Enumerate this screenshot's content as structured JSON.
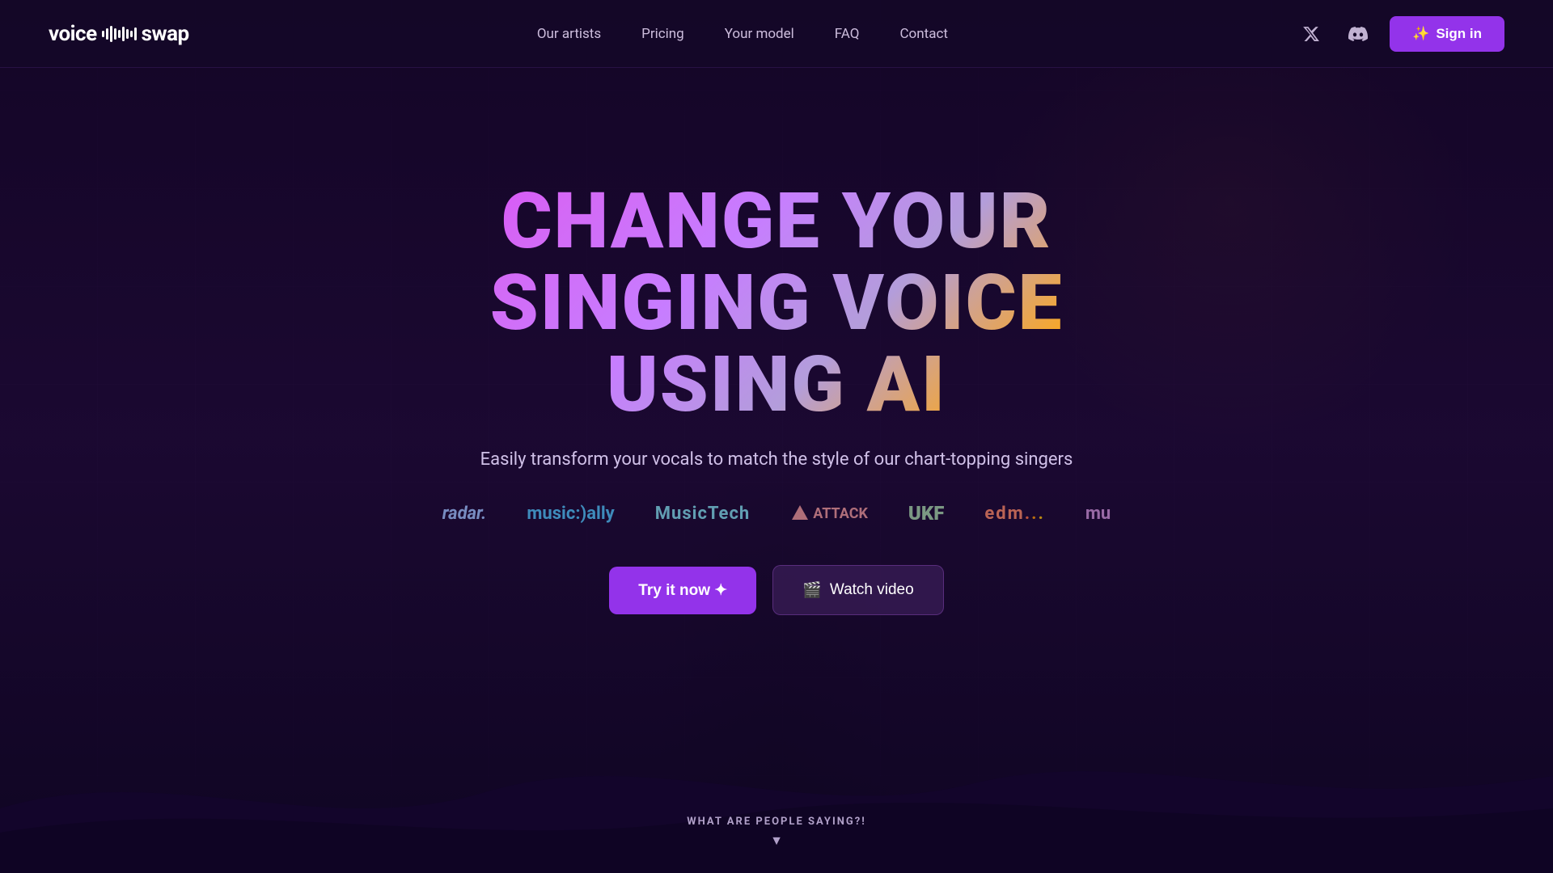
{
  "site": {
    "logo_voice": "voice",
    "logo_swap": "swap"
  },
  "nav": {
    "links": [
      {
        "id": "our-artists",
        "label": "Our artists"
      },
      {
        "id": "pricing",
        "label": "Pricing"
      },
      {
        "id": "your-model",
        "label": "Your model"
      },
      {
        "id": "faq",
        "label": "FAQ"
      },
      {
        "id": "contact",
        "label": "Contact"
      }
    ],
    "signin_label": "Sign in"
  },
  "hero": {
    "title_line1": "CHANGE YOUR SINGING VOICE",
    "title_line2": "USING AI",
    "subtitle": "Easily transform your vocals to match the style of our chart-topping singers",
    "cta_try": "Try it now ✦",
    "cta_watch": "Watch video"
  },
  "logos": [
    {
      "id": "radar",
      "label": "radar.",
      "class": "logo-radar"
    },
    {
      "id": "musicaly",
      "label": "music:)ally",
      "class": "logo-musicaly"
    },
    {
      "id": "musictech",
      "label": "MusicTech",
      "class": "logo-musictech"
    },
    {
      "id": "attack",
      "label": "⚡ ATTACK",
      "class": "logo-attack"
    },
    {
      "id": "ukf",
      "label": "UKF",
      "class": "logo-ukf"
    },
    {
      "id": "edm",
      "label": "edm...",
      "class": "logo-edm"
    },
    {
      "id": "mu",
      "label": "mu",
      "class": "logo-mu"
    }
  ],
  "scroll_hint": {
    "text": "WHAT ARE PEOPLE SAYING?!",
    "arrow": "▼"
  },
  "colors": {
    "brand_purple": "#9333ea",
    "nav_bg": "rgba(20, 8, 40, 0.9)",
    "hero_bg": "#1a0832",
    "title_gradient_start": "#e040fb",
    "title_gradient_end": "#ff8f00"
  }
}
